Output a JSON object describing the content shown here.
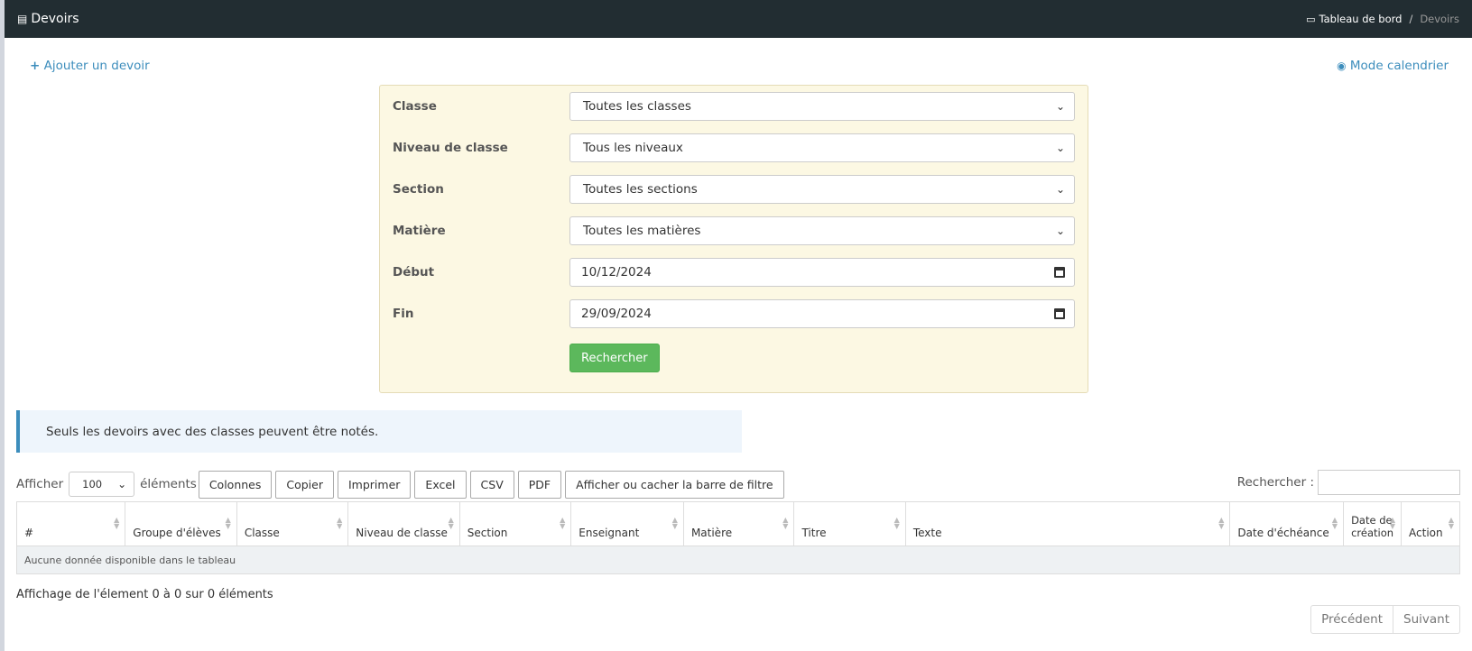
{
  "header": {
    "title": "Devoirs",
    "breadcrumb": {
      "home": "Tableau de bord",
      "separator": "/",
      "current": "Devoirs"
    }
  },
  "actions": {
    "add": "Ajouter un devoir",
    "calendar": "Mode calendrier"
  },
  "filters": {
    "classe": {
      "label": "Classe",
      "value": "Toutes les classes"
    },
    "niveau": {
      "label": "Niveau de classe",
      "value": "Tous les niveaux"
    },
    "section": {
      "label": "Section",
      "value": "Toutes les sections"
    },
    "matiere": {
      "label": "Matière",
      "value": "Toutes les matières"
    },
    "debut": {
      "label": "Début",
      "value": "10/12/2024"
    },
    "fin": {
      "label": "Fin",
      "value": "29/09/2024"
    },
    "search_button": "Rechercher"
  },
  "notice": "Seuls les devoirs avec des classes peuvent être notés.",
  "table_controls": {
    "show_label": "Afficher",
    "page_length": "100",
    "elements_label": "éléments",
    "buttons": [
      "Colonnes",
      "Copier",
      "Imprimer",
      "Excel",
      "CSV",
      "PDF",
      "Afficher ou cacher la barre de filtre"
    ],
    "search_label": "Rechercher :"
  },
  "table": {
    "columns": [
      "#",
      "Groupe d'élèves",
      "Classe",
      "Niveau de classe",
      "Section",
      "Enseignant",
      "Matière",
      "Titre",
      "Texte",
      "Date d'échéance",
      "Date de création",
      "Action"
    ],
    "empty_message": "Aucune donnée disponible dans le tableau"
  },
  "footer": {
    "info": "Affichage de l'élement 0 à 0 sur 0 éléments",
    "prev": "Précédent",
    "next": "Suivant"
  },
  "colors": {
    "topbar": "#222d32",
    "link": "#3c8dbc",
    "search_button": "#5cb85c",
    "filter_bg": "#fcf8e3",
    "notice_bg": "#eef5fc"
  }
}
